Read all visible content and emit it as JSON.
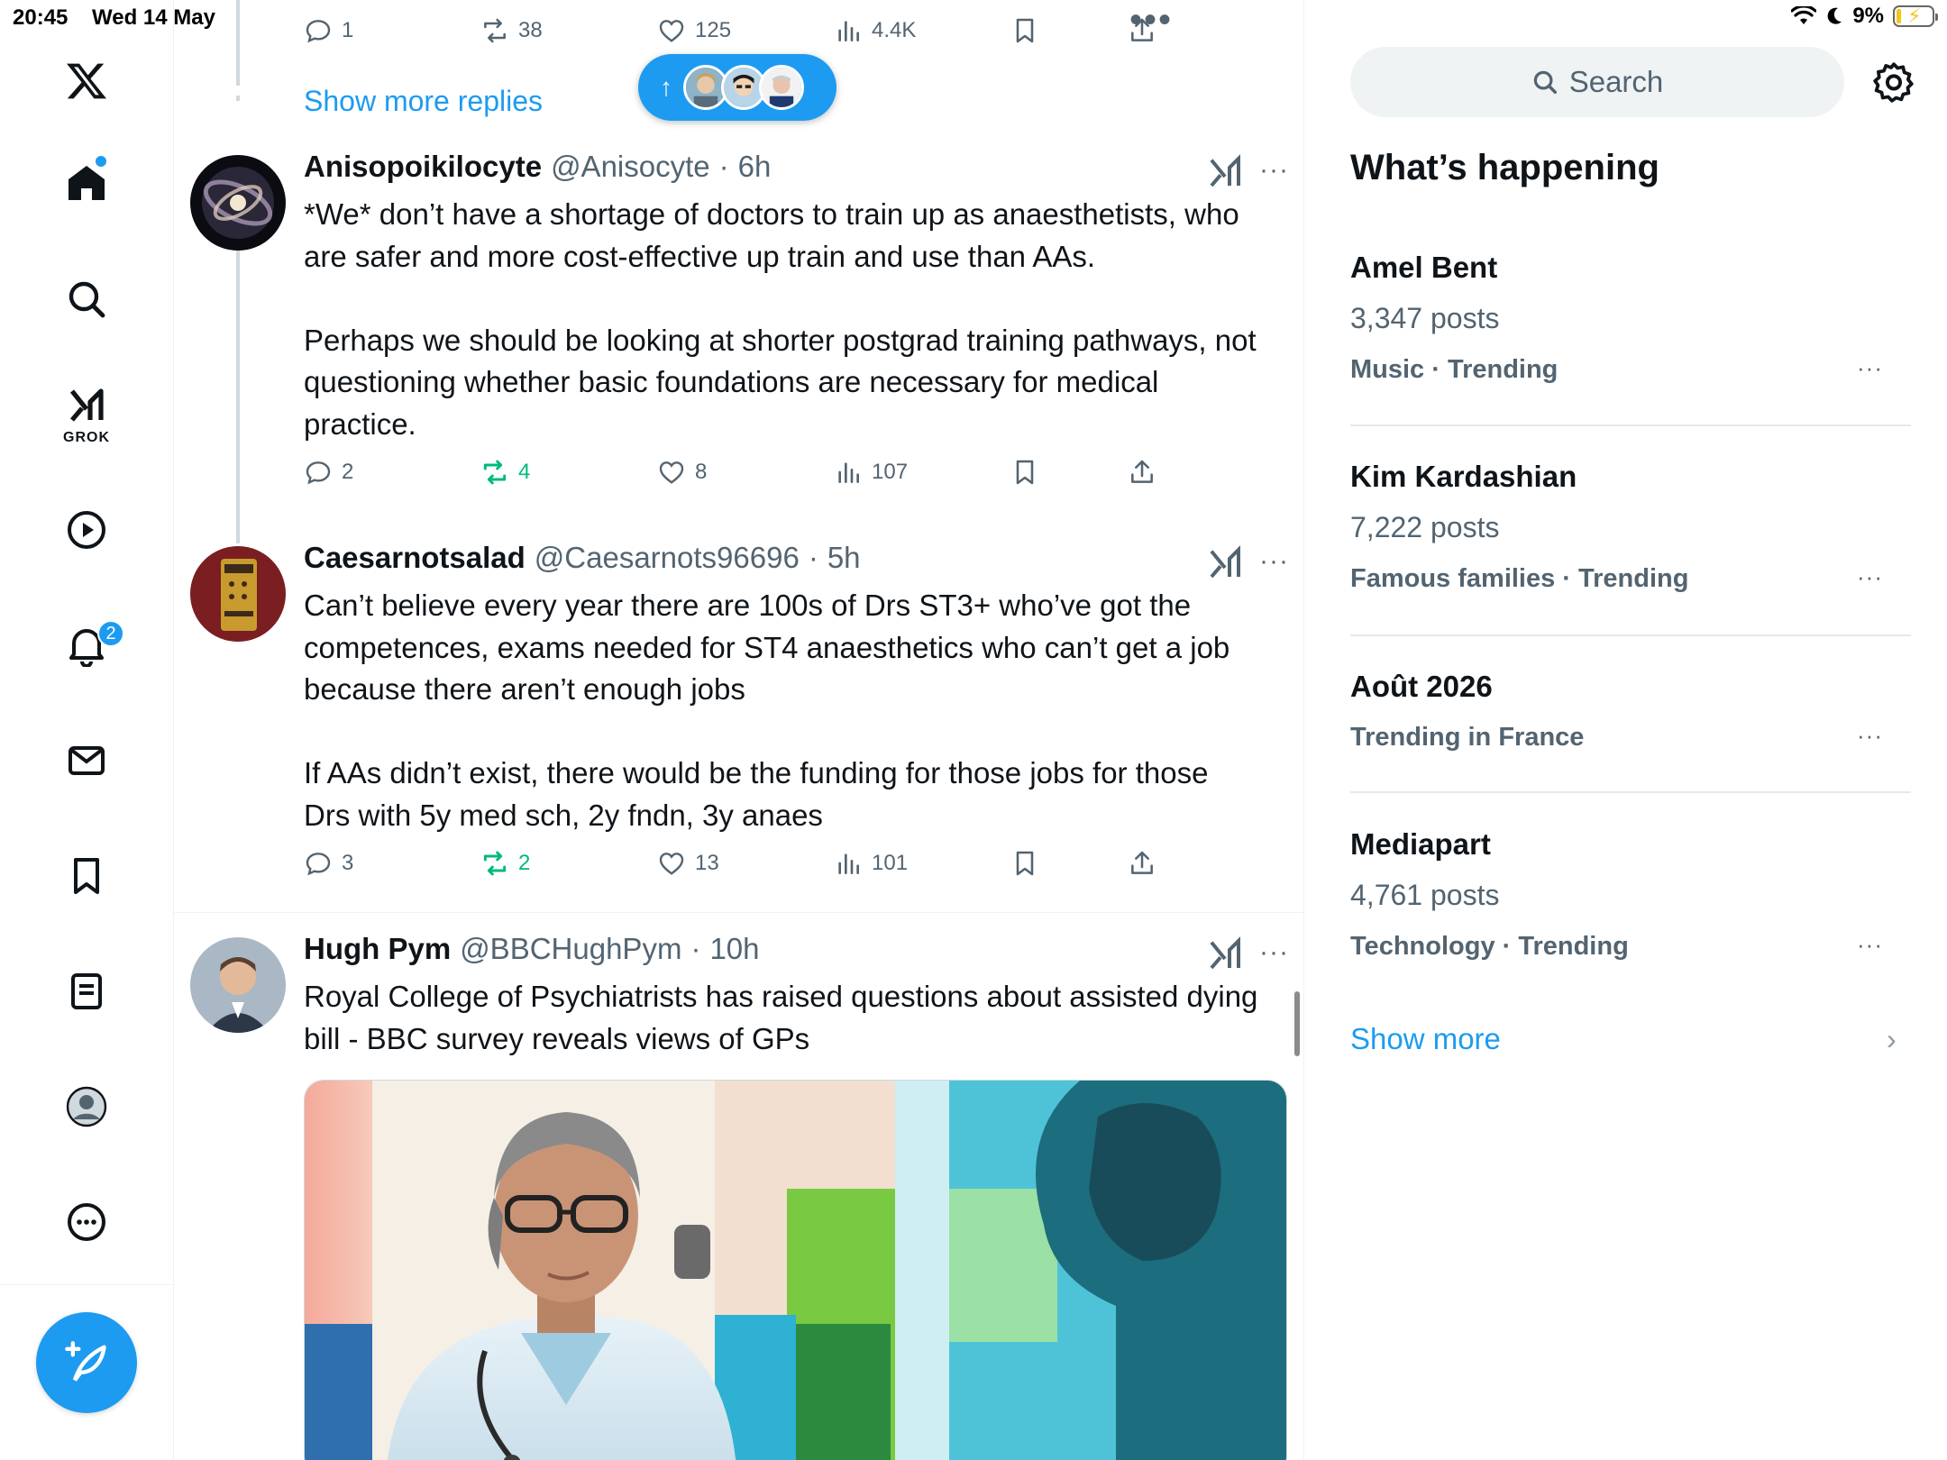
{
  "status_bar": {
    "time": "20:45",
    "date": "Wed 14 May",
    "battery_percent": "9%"
  },
  "nav": {
    "grok_label": "GROK",
    "notifications_badge": "2"
  },
  "top_action_bar": {
    "replies": "1",
    "reposts": "38",
    "likes": "125",
    "views": "4.4K"
  },
  "show_more_replies": "Show more replies",
  "tweets": [
    {
      "display_name": "Anisopoikilocyte",
      "handle": "@Anisocyte",
      "time": "6h",
      "body": "*We* don’t have a shortage of doctors to train up as anaesthetists, who are safer and more cost-effective up train and use than AAs.\n\nPerhaps we should be looking at shorter postgrad training pathways, not questioning whether basic foundations are necessary for medical practice.",
      "replies": "2",
      "reposts": "4",
      "likes": "8",
      "views": "107"
    },
    {
      "display_name": "Caesarnotsalad",
      "handle": "@Caesarnots96696",
      "time": "5h",
      "body": "Can’t believe every year there are 100s of Drs ST3+ who’ve got the competences, exams needed for ST4 anaesthetics who can’t get a job because there aren’t enough jobs\n\nIf AAs didn’t exist, there would be the funding for those jobs for those Drs with 5y med sch, 2y fndn, 3y anaes",
      "replies": "3",
      "reposts": "2",
      "likes": "13",
      "views": "101"
    },
    {
      "display_name": "Hugh Pym",
      "handle": "@BBCHughPym",
      "time": "10h",
      "body": "Royal College of Psychiatrists has raised questions about assisted dying bill - BBC survey reveals views of GPs"
    }
  ],
  "right": {
    "search_placeholder": "Search",
    "section_title": "What’s happening",
    "trends": [
      {
        "name": "Amel Bent",
        "posts": "3,347 posts",
        "meta": "Music · Trending"
      },
      {
        "name": "Kim Kardashian",
        "posts": "7,222 posts",
        "meta": "Famous families · Trending"
      },
      {
        "name": "Août 2026",
        "posts": "",
        "meta": "Trending in France"
      },
      {
        "name": "Mediapart",
        "posts": "4,761 posts",
        "meta": "Technology · Trending"
      }
    ],
    "show_more": "Show more"
  },
  "colors": {
    "accent": "#1d9bf0",
    "repost_active": "#00ba7c",
    "secondary_text": "#536471"
  }
}
